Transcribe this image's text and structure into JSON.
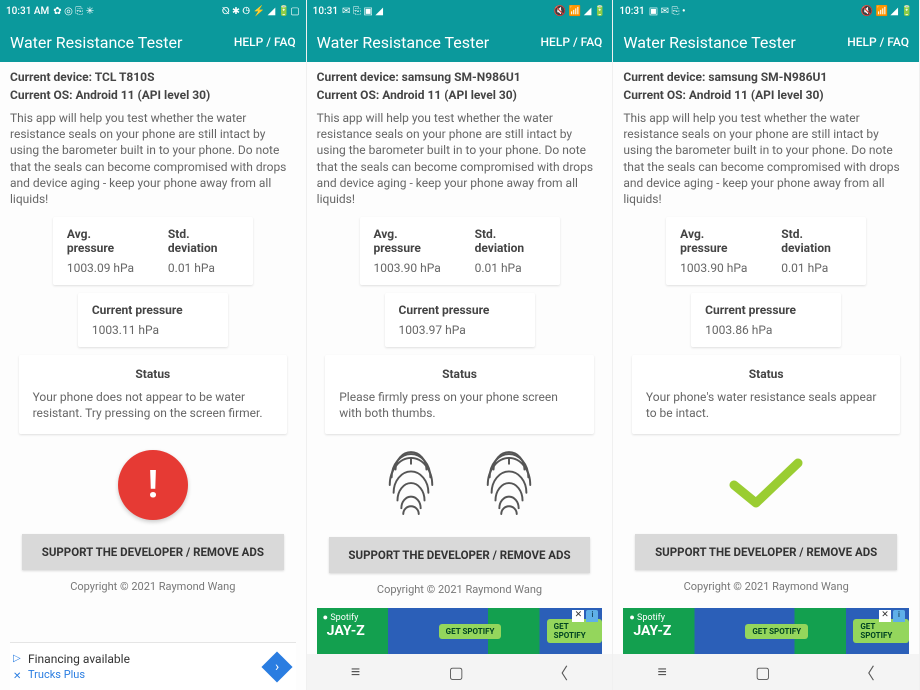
{
  "screens": [
    {
      "statusbar": {
        "time": "10:31 AM",
        "leftIcons": "✿ ◎ ⎘ ✳",
        "rightIcons": "⦰ ✱ ◷ ⚡ ◢ 🔋▢"
      },
      "appbar": {
        "title": "Water Resistance Tester",
        "help": "HELP / FAQ"
      },
      "device": "Current device: TCL T810S",
      "os": "Current OS: Android 11 (API level 30)",
      "desc": "This app will help you test whether the water resistance seals on your phone are still intact by using the barometer built in to your phone. Do note that the seals can become compromised with drops and device aging - keep your phone away from all liquids!",
      "avgLabel": "Avg. pressure",
      "avgVal": "1003.09 hPa",
      "stdLabel": "Std. deviation",
      "stdVal": "0.01 hPa",
      "curLabel": "Current pressure",
      "curVal": "1003.11 hPa",
      "statusLabel": "Status",
      "statusMsg": "Your phone does not appear to be water resistant. Try pressing on the screen firmer.",
      "support": "SUPPORT THE DEVELOPER / REMOVE ADS",
      "copyright": "Copyright © 2021 Raymond Wang",
      "ad": {
        "line1": "Financing available",
        "line2": "Trucks Plus"
      }
    },
    {
      "statusbar": {
        "time": "10:31",
        "leftIcons": "✉ ⎘ ▣ ◢",
        "rightIcons": "🔇 📶 ◢ 🔋"
      },
      "appbar": {
        "title": "Water Resistance Tester",
        "help": "HELP / FAQ"
      },
      "device": "Current device: samsung SM-N986U1",
      "os": "Current OS: Android 11 (API level 30)",
      "desc": "This app will help you test whether the water resistance seals on your phone are still intact by using the barometer built in to your phone. Do note that the seals can become compromised with drops and device aging - keep your phone away from all liquids!",
      "avgLabel": "Avg. pressure",
      "avgVal": "1003.90 hPa",
      "stdLabel": "Std. deviation",
      "stdVal": "0.01 hPa",
      "curLabel": "Current pressure",
      "curVal": "1003.97 hPa",
      "statusLabel": "Status",
      "statusMsg": "Please firmly press on your phone screen with both thumbs.",
      "support": "SUPPORT THE DEVELOPER / REMOVE ADS",
      "copyright": "Copyright © 2021 Raymond Wang",
      "ad": {
        "spotify": "● Spotify",
        "artist": "JAY-Z",
        "cta": "GET SPOTIFY"
      }
    },
    {
      "statusbar": {
        "time": "10:31",
        "leftIcons": "▣ ✉ ⎘ •",
        "rightIcons": "🔇 📶 ◢ 🔋"
      },
      "appbar": {
        "title": "Water Resistance Tester",
        "help": "HELP / FAQ"
      },
      "device": "Current device: samsung SM-N986U1",
      "os": "Current OS: Android 11 (API level 30)",
      "desc": "This app will help you test whether the water resistance seals on your phone are still intact by using the barometer built in to your phone. Do note that the seals can become compromised with drops and device aging - keep your phone away from all liquids!",
      "avgLabel": "Avg. pressure",
      "avgVal": "1003.90 hPa",
      "stdLabel": "Std. deviation",
      "stdVal": "0.01 hPa",
      "curLabel": "Current pressure",
      "curVal": "1003.86 hPa",
      "statusLabel": "Status",
      "statusMsg": "Your phone's water resistance seals appear to be intact.",
      "support": "SUPPORT THE DEVELOPER / REMOVE ADS",
      "copyright": "Copyright © 2021 Raymond Wang",
      "ad": {
        "spotify": "● Spotify",
        "artist": "JAY-Z",
        "cta": "GET SPOTIFY"
      }
    }
  ]
}
